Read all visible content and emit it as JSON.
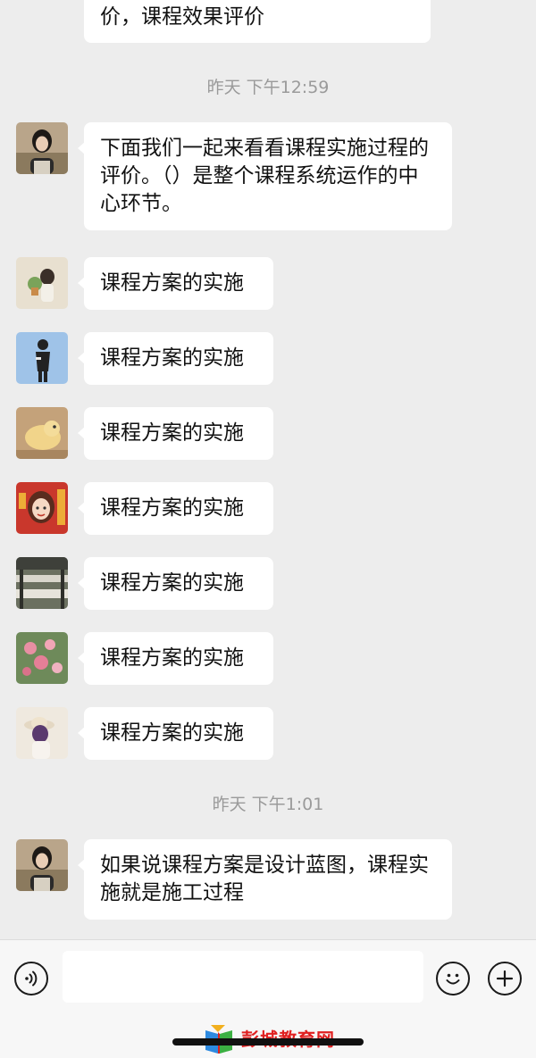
{
  "messages": {
    "partial_prev": "价，课程效果评价",
    "ts1": "昨天 下午12:59",
    "m1": "下面我们一起来看看课程实施过程的评价。（）是整个课程系统运作的中心环节。",
    "reply": "课程方案的实施",
    "ts2": "昨天 下午1:01",
    "m_last": "如果说课程方案是设计蓝图，课程实施就是施工过程"
  },
  "watermark": {
    "text": "彭城教育网"
  },
  "colors": {
    "background": "#ededed",
    "bubble": "#ffffff",
    "timestamp": "#9a9a9a",
    "watermark": "#e02020"
  },
  "icons": {
    "voice": "voice-icon",
    "emoji": "emoji-icon",
    "more": "plus-icon"
  }
}
